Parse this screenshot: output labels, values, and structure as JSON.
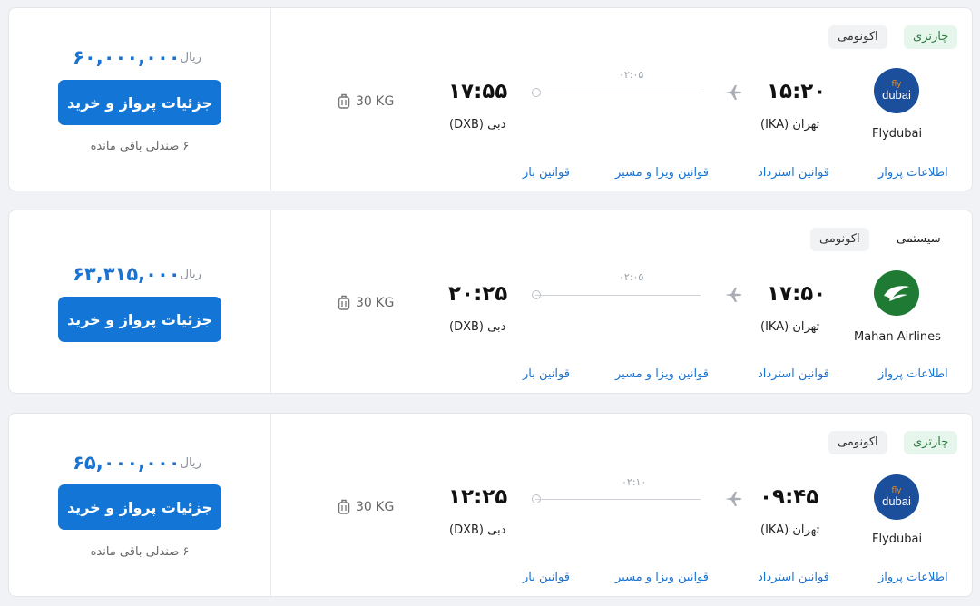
{
  "currency_label": "ریال",
  "buy_button_label": "جزئیات پرواز و خرید",
  "baggage_allowance": "30 KG",
  "links": {
    "flight_info": "اطلاعات پرواز",
    "refund_rules": "قوانین استرداد",
    "visa_rules": "قوانین ویزا و مسیر",
    "baggage_rules": "قوانین بار"
  },
  "flights": [
    {
      "airline": "Flydubai",
      "logo_text_top": "fly",
      "logo_text_bottom": "dubai",
      "flight_type": "چارتری",
      "cabin_class": "اکونومی",
      "price": "۶۰,۰۰۰,۰۰۰",
      "seats_left": "۶ صندلی باقی مانده",
      "departure_time": "۱۵:۲۰",
      "departure_city": "تهران (IKA)",
      "arrival_time": "۱۷:۵۵",
      "arrival_city": "دبی (DXB)",
      "duration": "۰۲:۰۵"
    },
    {
      "airline": "Mahan Airlines",
      "flight_type": "سیستمی",
      "cabin_class": "اکونومی",
      "price": "۶۳,۳۱۵,۰۰۰",
      "departure_time": "۱۷:۵۰",
      "departure_city": "تهران (IKA)",
      "arrival_time": "۲۰:۲۵",
      "arrival_city": "دبی (DXB)",
      "duration": "۰۲:۰۵"
    },
    {
      "airline": "Flydubai",
      "logo_text_top": "fly",
      "logo_text_bottom": "dubai",
      "flight_type": "چارتری",
      "cabin_class": "اکونومی",
      "price": "۶۵,۰۰۰,۰۰۰",
      "seats_left": "۶ صندلی باقی مانده",
      "departure_time": "۰۹:۴۵",
      "departure_city": "تهران (IKA)",
      "arrival_time": "۱۲:۲۵",
      "arrival_city": "دبی (DXB)",
      "duration": "۰۲:۱۰"
    }
  ],
  "colors": {
    "accent": "#1376d6",
    "price": "#1a73d1",
    "charter_badge_bg": "#e7f6ec",
    "flydubai_logo": "#1b4f9c",
    "mahan_logo": "#1f7a34"
  }
}
